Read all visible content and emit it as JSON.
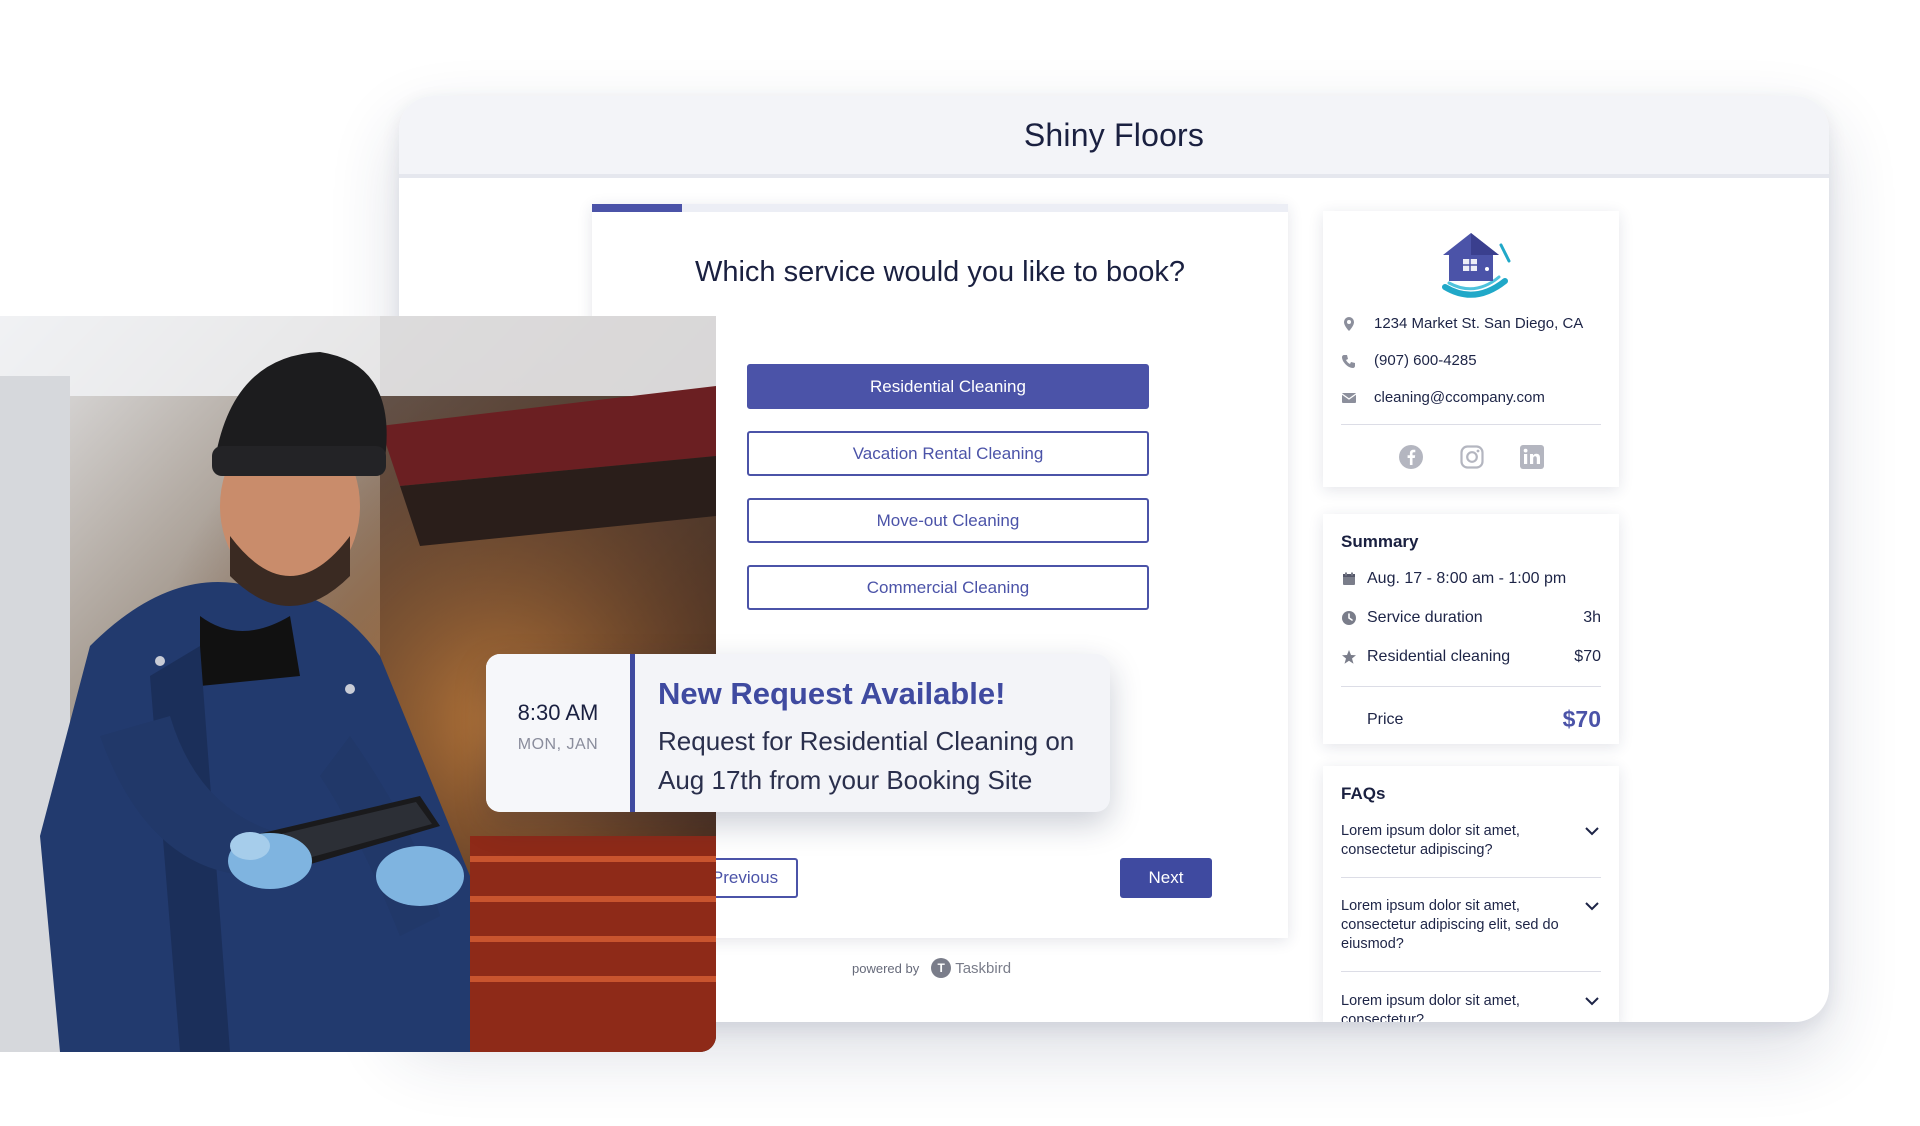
{
  "window": {
    "title": "Shiny Floors"
  },
  "progress": {
    "fraction": 0.13
  },
  "booking": {
    "question": "Which service would you like to book?",
    "services": [
      {
        "label": "Residential Cleaning",
        "selected": true
      },
      {
        "label": "Vacation Rental Cleaning",
        "selected": false
      },
      {
        "label": "Move-out Cleaning",
        "selected": false
      },
      {
        "label": "Commercial Cleaning",
        "selected": false
      }
    ],
    "previous_label": "Previous",
    "next_label": "Next"
  },
  "footer": {
    "powered_by": "powered by",
    "brand": "Taskbird",
    "brand_initial": "T"
  },
  "contact": {
    "address": "1234 Market St. San Diego, CA",
    "phone": "(907) 600-4285",
    "email": "cleaning@ccompany.com",
    "icons": [
      "location-pin-icon",
      "phone-icon",
      "email-icon"
    ],
    "social": [
      "facebook-icon",
      "instagram-icon",
      "linkedin-icon"
    ]
  },
  "summary": {
    "title": "Summary",
    "date": "Aug. 17 - 8:00 am - 1:00 pm",
    "duration_label": "Service duration",
    "duration_value": "3h",
    "service_label": "Residential cleaning",
    "service_value": "$70",
    "price_label": "Price",
    "price_value": "$70"
  },
  "faqs": {
    "title": "FAQs",
    "items": [
      "Lorem ipsum dolor sit amet, consectetur adipiscing?",
      "Lorem ipsum dolor sit amet, consectetur adipiscing elit, sed do eiusmod?",
      "Lorem ipsum dolor sit amet, consectetur?"
    ]
  },
  "notification": {
    "time": "8:30 AM",
    "day": "MON, JAN",
    "title": "New Request Available!",
    "body": "Request for Residential Cleaning on Aug 17th from your Booking Site"
  },
  "colors": {
    "accent": "#4b53a8",
    "text": "#1a2040",
    "header_bg": "#f3f4f8",
    "logo_teal": "#20a8c8"
  }
}
